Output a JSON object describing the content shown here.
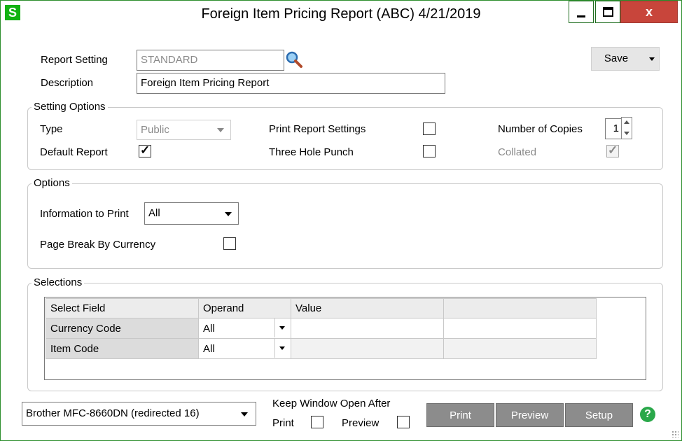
{
  "window": {
    "app_icon_letter": "S",
    "title": "Foreign Item Pricing Report (ABC) 4/21/2019",
    "close_glyph": "x"
  },
  "report_setting": {
    "label": "Report Setting",
    "value": "STANDARD",
    "lookup_icon": "magnifier-icon"
  },
  "description": {
    "label": "Description",
    "value": "Foreign Item Pricing Report"
  },
  "save_button": {
    "label": "Save"
  },
  "setting_options": {
    "title": "Setting Options",
    "type_label": "Type",
    "type_value": "Public",
    "default_report_label": "Default Report",
    "default_report_checked": true,
    "print_settings_label": "Print Report Settings",
    "print_settings_checked": false,
    "three_hole_label": "Three Hole Punch",
    "three_hole_checked": false,
    "copies_label": "Number of Copies",
    "copies_value": "1",
    "collated_label": "Collated",
    "collated_checked": true
  },
  "options": {
    "title": "Options",
    "info_label": "Information to Print",
    "info_value": "All",
    "page_break_label": "Page Break By Currency",
    "page_break_checked": false
  },
  "selections": {
    "title": "Selections",
    "columns": [
      "Select Field",
      "Operand",
      "Value",
      ""
    ],
    "rows": [
      {
        "field": "Currency Code",
        "operand": "All",
        "value": ""
      },
      {
        "field": "Item Code",
        "operand": "All",
        "value": ""
      }
    ]
  },
  "footer": {
    "printer_value": "Brother MFC-8660DN (redirected 16)",
    "keep_open_label": "Keep Window Open After",
    "keep_print_label": "Print",
    "keep_preview_label": "Preview",
    "print_button": "Print",
    "preview_button": "Preview",
    "setup_button": "Setup",
    "help_glyph": "?"
  },
  "colors": {
    "title_border": "#2d8f2d",
    "close_button": "#c8453b",
    "action_button": "#8c8c8c",
    "app_icon": "#12b312",
    "help_icon": "#2aa84a"
  }
}
